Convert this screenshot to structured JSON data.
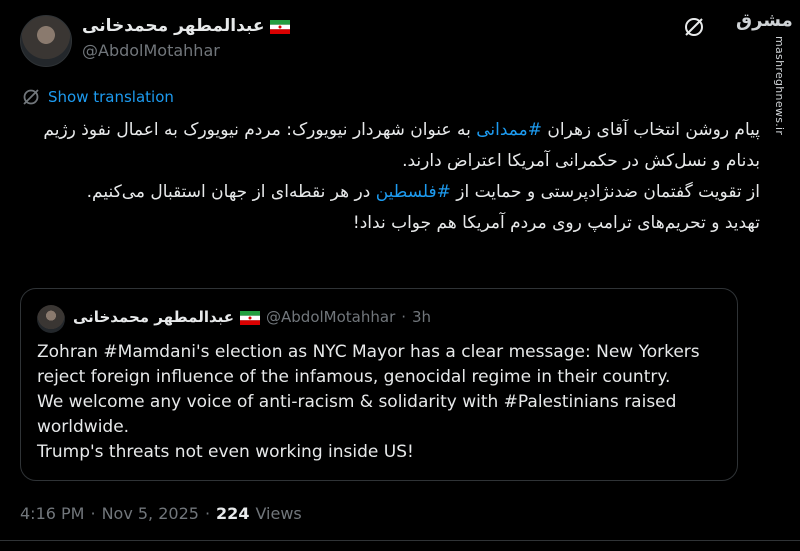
{
  "author": {
    "display_name": "عبدالمطهر محمدخانی",
    "handle": "@AbdolMotahhar"
  },
  "flag_icon": "iran-flag-icon",
  "colors": {
    "accent": "#1d9bf0",
    "text": "#e7e9ea",
    "muted": "#71767b",
    "border": "#2f3336"
  },
  "watermark": {
    "top": "مشرق",
    "side": "mashreghnews.ir"
  },
  "translation": {
    "label": "Show translation"
  },
  "tweet": {
    "lines": [
      {
        "before": "پیام روشن انتخاب آقای زهران ",
        "tag": "#ممدانی",
        "after": " به عنوان شهردار نیویورک: مردم نیویورک به اعمال نفوذ رژیم بدنام و نسل‌کش در حکمرانی آمریکا اعتراض دارند."
      },
      {
        "before": "از تقویت گفتمان ضدنژادپرستی و حمایت از ",
        "tag": "#فلسطین",
        "after": " در هر نقطه‌ای از جهان استقبال می‌کنیم."
      },
      {
        "before": "تهدید و تحریم‌های ترامپ روی مردم آمریکا هم جواب نداد!",
        "tag": "",
        "after": ""
      }
    ]
  },
  "quote": {
    "display_name": "عبدالمطهر محمدخانی",
    "handle": "@AbdolMotahhar",
    "separator": "·",
    "time": "3h",
    "lines": [
      "Zohran #Mamdani's election as NYC Mayor has a clear message: New Yorkers reject foreign influence of the infamous, genocidal regime in their country.",
      "We welcome any voice of anti-racism & solidarity with #Palestinians raised worldwide.",
      "Trump's threats not even working inside US!"
    ]
  },
  "meta": {
    "time": "4:16 PM",
    "dot1": "·",
    "date": "Nov 5, 2025",
    "dot2": "·",
    "views_count": "224",
    "views_label": "Views"
  }
}
